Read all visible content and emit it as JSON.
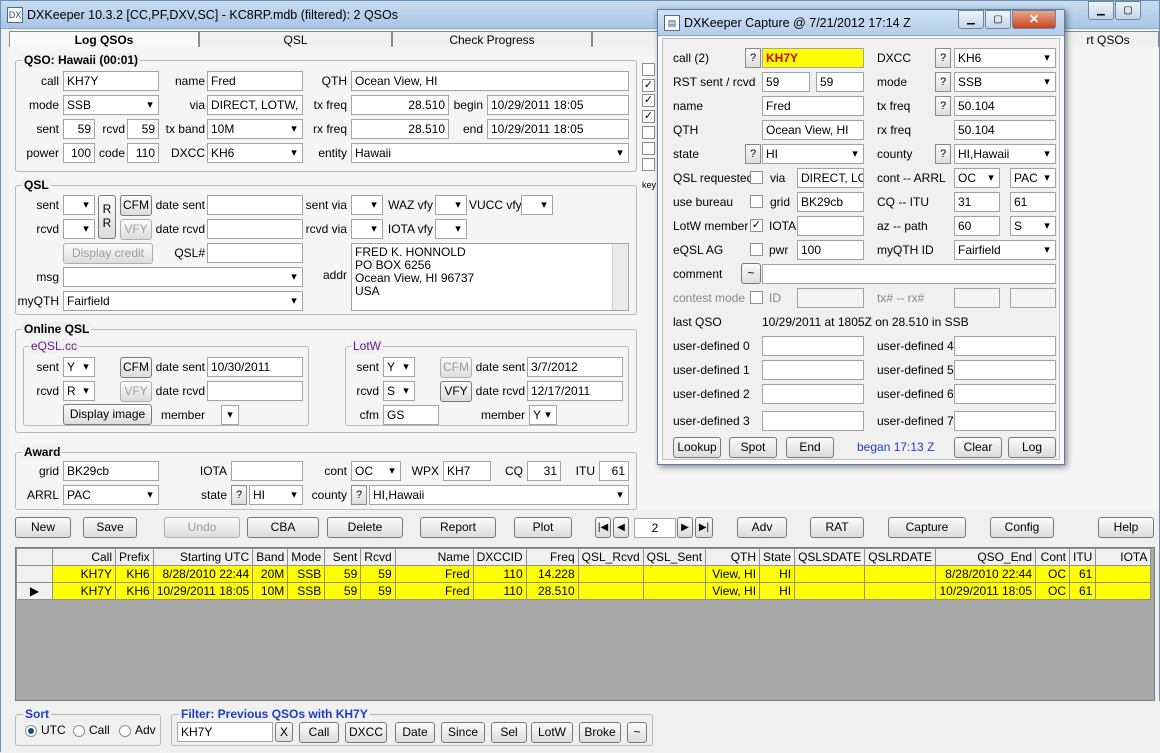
{
  "app": {
    "title": "DXKeeper 10.3.2 [CC,PF,DXV,SC] - KC8RP.mdb (filtered): 2 QSOs",
    "tabs": [
      "Log QSOs",
      "QSL",
      "Check Progress",
      "rt QSOs"
    ]
  },
  "qso": {
    "legend": "QSO: Hawaii (00:01)",
    "call_label": "call",
    "call": "KH7Y",
    "name_label": "name",
    "name": "Fred",
    "qth_label": "QTH",
    "qth": "Ocean View, HI",
    "mode_label": "mode",
    "mode": "SSB",
    "via_label": "via",
    "via": "DIRECT, LOTW, B",
    "txfreq_label": "tx freq",
    "txfreq": "28.510",
    "begin_label": "begin",
    "begin": "10/29/2011   18:05",
    "sent_label": "sent",
    "sent": "59",
    "rcvd_label": "rcvd",
    "rcvd": "59",
    "txband_label": "tx band",
    "txband": "10M",
    "rxfreq_label": "rx freq",
    "rxfreq": "28.510",
    "end_label": "end",
    "end": "10/29/2011   18:05",
    "power_label": "power",
    "power": "100",
    "code_label": "code",
    "code": "110",
    "dxcc_label": "DXCC",
    "dxcc": "KH6",
    "entity_label": "entity",
    "entity": "Hawaii"
  },
  "qsl": {
    "legend": "QSL",
    "sent_label": "sent",
    "rcvd_label": "rcvd",
    "rr": "R R",
    "cfm": "CFM",
    "vfy": "VFY",
    "datesent_label": "date sent",
    "daterecvd_label": "date rcvd",
    "sentvia_label": "sent via",
    "rcvdvia_label": "rcvd via",
    "waz_label": "WAZ vfy",
    "vucc_label": "VUCC vfy",
    "iota_label": "IOTA vfy",
    "display_credit": "Display credit",
    "qslnum_label": "QSL#",
    "msg_label": "msg",
    "myqth_label": "myQTH",
    "myqth": "Fairfield",
    "addr_label": "addr",
    "addr": "FRED K. HONNOLD\nPO BOX 6256\nOcean View, HI 96737\nUSA"
  },
  "online": {
    "legend": "Online QSL",
    "eqsl_legend": "eQSL.cc",
    "eqsl_sent": "Y",
    "eqsl_rcvd": "R",
    "cfm": "CFM",
    "vfy": "VFY",
    "eqsl_datesent": "10/30/2011",
    "display_image": "Display image",
    "member_label": "member",
    "sent_label": "sent",
    "rcvd_label": "rcvd",
    "datesent_label": "date sent",
    "daterecvd_label": "date rcvd",
    "lotw_legend": "LotW",
    "lotw_sent": "Y",
    "lotw_rcvd": "S",
    "lotw_datesent": "3/7/2012",
    "lotw_daterecvd": "12/17/2011",
    "cfm_label": "cfm",
    "lotw_cfm": "GS",
    "lotw_member": "Y"
  },
  "award": {
    "legend": "Award",
    "grid_label": "grid",
    "grid": "BK29cb",
    "iota_label": "IOTA",
    "cont_label": "cont",
    "cont": "OC",
    "wpx_label": "WPX",
    "wpx": "KH7",
    "cq_label": "CQ",
    "cq": "31",
    "itu_label": "ITU",
    "itu": "61",
    "arrl_label": "ARRL",
    "arrl": "PAC",
    "state_label": "state",
    "state": "HI",
    "county_label": "county",
    "county": "HI,Hawaii"
  },
  "checks": {
    "key_label": "key"
  },
  "toolbar": {
    "new": "New",
    "save": "Save",
    "undo": "Undo",
    "cba": "CBA",
    "delete": "Delete",
    "report": "Report",
    "plot": "Plot",
    "page": "2",
    "adv": "Adv",
    "rat": "RAT",
    "capture": "Capture",
    "config": "Config",
    "help": "Help"
  },
  "log": {
    "columns": [
      "",
      "Call",
      "Prefix",
      "Starting UTC",
      "Band",
      "Mode",
      "Sent",
      "Rcvd",
      "Name",
      "DXCCID",
      "Freq",
      "QSL_Rcvd",
      "QSL_Sent",
      "QTH",
      "State",
      "QSLSDATE",
      "QSLRDATE",
      "QSO_End",
      "Cont",
      "ITU",
      "IOTA"
    ],
    "rows": [
      [
        "",
        "KH7Y",
        "KH6",
        "8/28/2010   22:44",
        "20M",
        "SSB",
        "59",
        "59",
        "Fred",
        "110",
        "14.228",
        "",
        "",
        "View, HI",
        "HI",
        "",
        "",
        "8/28/2010   22:44",
        "OC",
        "61",
        ""
      ],
      [
        "▶",
        "KH7Y",
        "KH6",
        "10/29/2011   18:05",
        "10M",
        "SSB",
        "59",
        "59",
        "Fred",
        "110",
        "28.510",
        "",
        "",
        "View, HI",
        "HI",
        "",
        "",
        "10/29/2011   18:05",
        "OC",
        "61",
        ""
      ]
    ]
  },
  "sort": {
    "legend": "Sort",
    "utc": "UTC",
    "call": "Call",
    "adv": "Adv"
  },
  "filter": {
    "legend": "Filter: Previous QSOs with KH7Y",
    "value": "KH7Y",
    "x": "X",
    "buttons": [
      "Call",
      "DXCC",
      "Date",
      "Since",
      "Sel",
      "LotW",
      "Broke",
      "~"
    ]
  },
  "capture": {
    "title": "DXKeeper Capture @ 7/21/2012    17:14 Z",
    "call_label": "call (2)",
    "call": "KH7Y",
    "dxcc_label": "DXCC",
    "dxcc": "KH6",
    "rst_label": "RST sent / rcvd",
    "rst_sent": "59",
    "rst_rcvd": "59",
    "mode_label": "mode",
    "mode": "SSB",
    "name_label": "name",
    "name": "Fred",
    "txfreq_label": "tx freq",
    "txfreq": "50.104",
    "qth_label": "QTH",
    "qth": "Ocean View, HI",
    "rxfreq_label": "rx freq",
    "rxfreq": "50.104",
    "state_label": "state",
    "state": "HI",
    "county_label": "county",
    "county": "HI,Hawaii",
    "qslreq_label": "QSL requested",
    "via_label": "via",
    "via": "DIRECT, LOTW",
    "contarrl_label": "cont -- ARRL",
    "cont": "OC",
    "arrl": "PAC",
    "usebureau_label": "use bureau",
    "grid_label": "grid",
    "grid": "BK29cb",
    "cqitu_label": "CQ  -- ITU",
    "cq": "31",
    "itu": "61",
    "lotw_label": "LotW member",
    "iota_label": "IOTA",
    "azpath_label": "az  -- path",
    "az": "60",
    "path": "S",
    "eqslag_label": "eQSL AG",
    "pwr_label": "pwr",
    "pwr": "100",
    "myqth_label": "myQTH ID",
    "myqth": "Fairfield",
    "comment_label": "comment",
    "tilde": "~",
    "contest_label": "contest mode",
    "id_label": "ID",
    "txrx_label": "tx#  -- rx#",
    "lastqso_label": "last QSO",
    "lastqso": "10/29/2011 at 1805Z on 28.510 in SSB",
    "ud": [
      "user-defined 0",
      "user-defined 1",
      "user-defined 2",
      "user-defined 3",
      "user-defined 4",
      "user-defined 5",
      "user-defined 6",
      "user-defined 7"
    ],
    "lookup": "Lookup",
    "spot": "Spot",
    "end": "End",
    "began": "began 17:13 Z",
    "clear": "Clear",
    "log": "Log",
    "q": "?"
  },
  "colors": {
    "highlight": "#ffff00",
    "accent": "#1c3fbf",
    "eqsl": "#6a1a8a"
  }
}
